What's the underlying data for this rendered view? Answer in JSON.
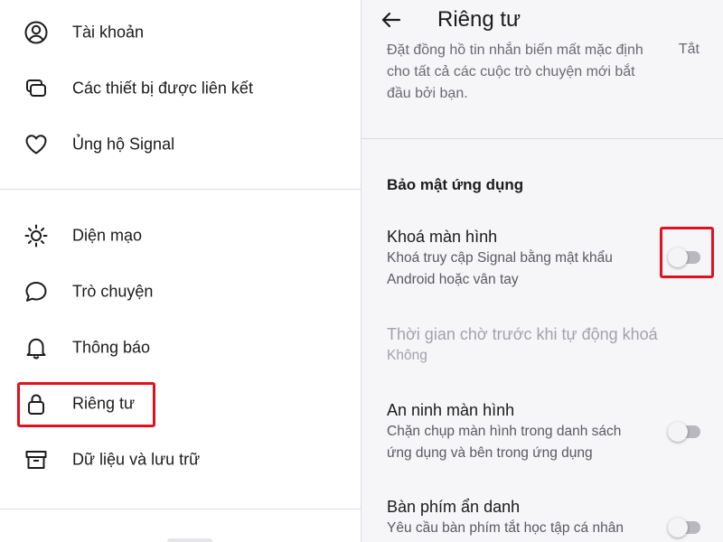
{
  "left_menu": {
    "items": [
      {
        "label": "Tài khoản",
        "icon": "account-circle-icon"
      },
      {
        "label": "Các thiết bị được liên kết",
        "icon": "linked-devices-icon"
      },
      {
        "label": "Ủng hộ Signal",
        "icon": "heart-icon"
      },
      {
        "label": "Diện mạo",
        "icon": "appearance-sun-icon"
      },
      {
        "label": "Trò chuyện",
        "icon": "chat-bubble-icon"
      },
      {
        "label": "Thông báo",
        "icon": "bell-icon"
      },
      {
        "label": "Riêng tư",
        "icon": "lock-icon",
        "highlighted": true
      },
      {
        "label": "Dữ liệu và lưu trữ",
        "icon": "archive-box-icon"
      }
    ]
  },
  "privacy": {
    "title": "Riêng tư",
    "back_icon": "arrow-back-icon",
    "disappearing_partial": {
      "text_lines": [
        "Đặt đồng hồ tin nhắn biến mất mặc định",
        "cho tất cả các cuộc trò chuyện mới bắt",
        "đầu bởi bạn."
      ],
      "value": "Tắt"
    },
    "section_title": "Bảo mật ứng dụng",
    "rows": [
      {
        "title": "Khoá màn hình",
        "desc_lines": [
          "Khoá truy cập Signal bằng mật khẩu",
          "Android hoặc vân tay"
        ],
        "toggle": false,
        "highlighted": true
      },
      {
        "title": "Thời gian chờ trước khi tự động khoá",
        "desc_lines": [
          "Không"
        ],
        "disabled": true
      },
      {
        "title": "An ninh màn hình",
        "desc_lines": [
          "Chặn chụp màn hình trong danh sách",
          "ứng dụng và bên trong ứng dụng"
        ],
        "toggle": false
      },
      {
        "title": "Bàn phím ẩn danh",
        "desc_lines": [
          "Yêu cầu bàn phím tắt học tập cá nhân"
        ],
        "toggle": false
      }
    ]
  },
  "colors": {
    "highlight": "#e2101e",
    "panel_bg": "#f6f6f9",
    "toggle_track": "#b9b9bd"
  }
}
